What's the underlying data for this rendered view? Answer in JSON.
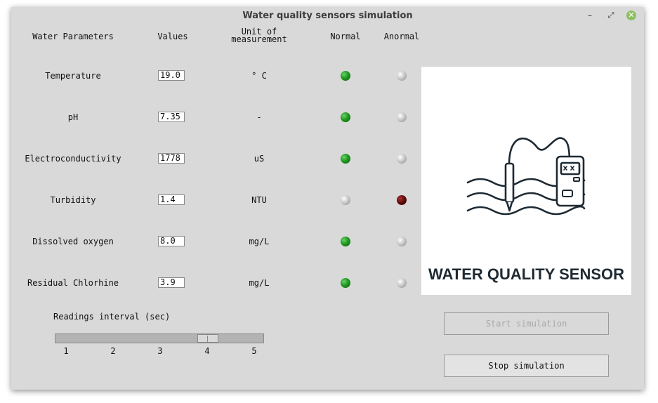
{
  "window": {
    "title": "Water quality sensors simulation",
    "controls": {
      "minimize": "–",
      "maximize": "⤢",
      "close": "✕"
    }
  },
  "headers": {
    "parameters": "Water Parameters",
    "values": "Values",
    "unit_line1": "Unit of",
    "unit_line2": "measurement",
    "normal": "Normal",
    "anormal": "Anormal"
  },
  "rows": [
    {
      "name": "Temperature",
      "value": "19.0",
      "unit": "° C",
      "normal": "green",
      "anormal": "gray"
    },
    {
      "name": "pH",
      "value": "7.35",
      "unit": "-",
      "normal": "green",
      "anormal": "gray"
    },
    {
      "name": "Electroconductivity",
      "value": "1778",
      "unit": "uS",
      "normal": "green",
      "anormal": "gray"
    },
    {
      "name": "Turbidity",
      "value": "1.4",
      "unit": "NTU",
      "normal": "gray",
      "anormal": "red"
    },
    {
      "name": "Dissolved oxygen",
      "value": "8.0",
      "unit": "mg/L",
      "normal": "green",
      "anormal": "gray"
    },
    {
      "name": "Residual Chlorhine",
      "value": "3.9",
      "unit": "mg/L",
      "normal": "green",
      "anormal": "gray"
    }
  ],
  "image": {
    "caption": "WATER QUALITY SENSOR",
    "icon": "water-quality-sensor-icon"
  },
  "slider": {
    "label": "Readings interval (sec)",
    "ticks": [
      "1",
      "2",
      "3",
      "4",
      "5"
    ],
    "min": 1,
    "max": 5,
    "value": 4
  },
  "buttons": {
    "start": "Start simulation",
    "stop": "Stop simulation",
    "start_enabled": false
  },
  "colors": {
    "led_on_green": "#1f9a1f",
    "led_off_gray": "#c4c4c4",
    "led_alarm_red": "#5e0a0a",
    "window_bg": "#d9d9d9"
  }
}
